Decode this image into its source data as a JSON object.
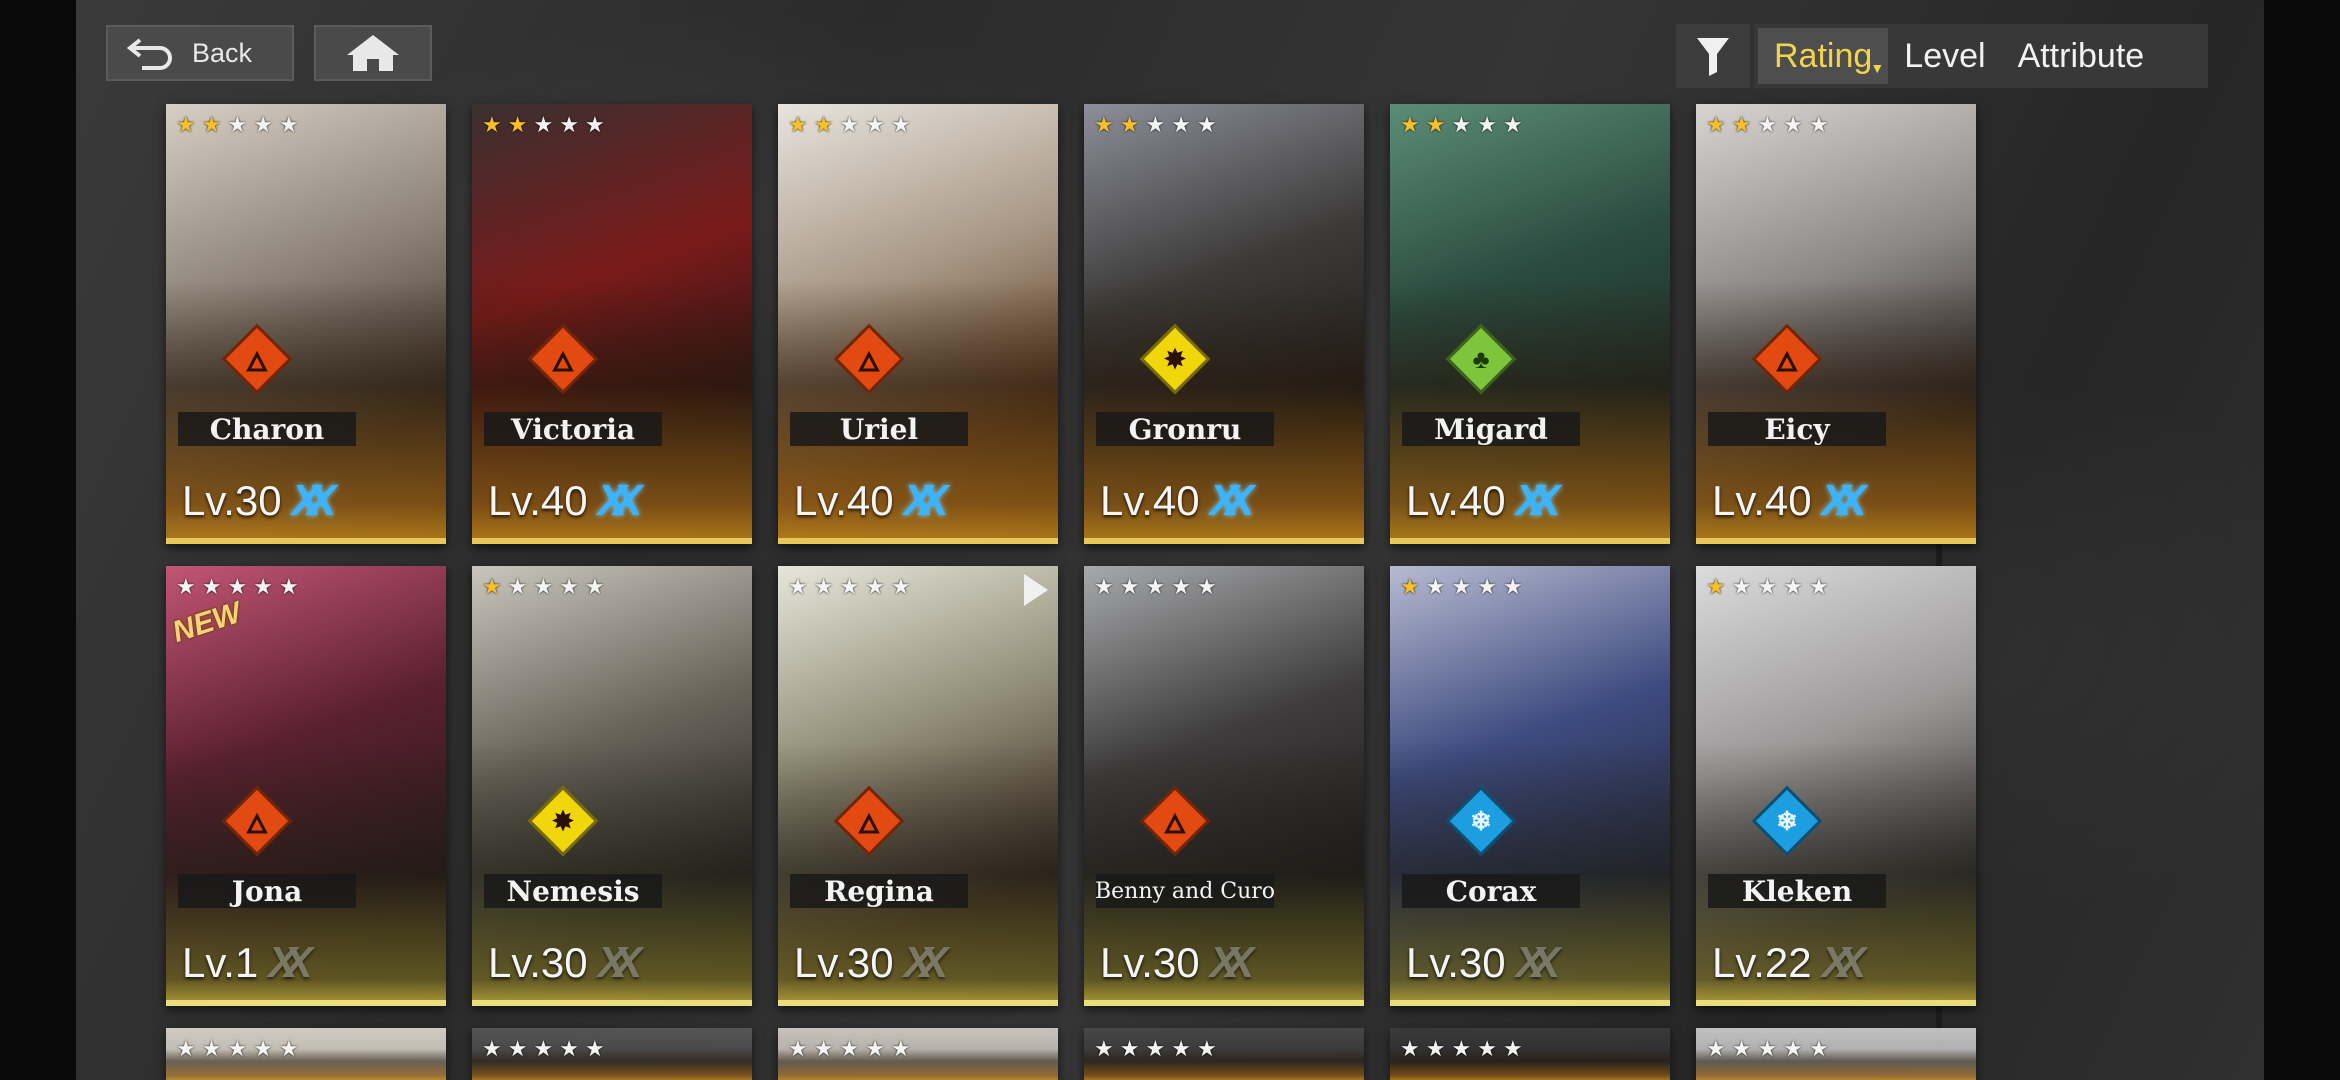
{
  "nav": {
    "back_label": "Back",
    "back_icon": "back-arrow-icon",
    "home_icon": "home-icon"
  },
  "sort": {
    "filter_icon": "filter-icon",
    "tabs": [
      {
        "label": "Rating",
        "active": true
      },
      {
        "label": "Level",
        "active": false
      },
      {
        "label": "Attribute",
        "active": false
      }
    ],
    "active_color": "#f1d44c"
  },
  "attribute_colors": {
    "fire": "#e24a12",
    "electric": "#f1d60c",
    "nature": "#7dc53a",
    "ice": "#1d9ee0"
  },
  "characters": [
    {
      "name": "Charon",
      "level": "Lv.30",
      "stars": 2,
      "attribute": "fire",
      "limit_break": true
    },
    {
      "name": "Victoria",
      "level": "Lv.40",
      "stars": 2,
      "attribute": "fire",
      "limit_break": true
    },
    {
      "name": "Uriel",
      "level": "Lv.40",
      "stars": 2,
      "attribute": "fire",
      "limit_break": true
    },
    {
      "name": "Gronru",
      "level": "Lv.40",
      "stars": 2,
      "attribute": "electric",
      "limit_break": true
    },
    {
      "name": "Migard",
      "level": "Lv.40",
      "stars": 2,
      "attribute": "nature",
      "limit_break": true
    },
    {
      "name": "Eicy",
      "level": "Lv.40",
      "stars": 2,
      "attribute": "fire",
      "limit_break": true
    },
    {
      "name": "Jona",
      "level": "Lv.1",
      "stars": 0,
      "attribute": "fire",
      "limit_break": false,
      "badge": "NEW"
    },
    {
      "name": "Nemesis",
      "level": "Lv.30",
      "stars": 1,
      "attribute": "electric",
      "limit_break": false
    },
    {
      "name": "Regina",
      "level": "Lv.30",
      "stars": 0,
      "attribute": "fire",
      "limit_break": false
    },
    {
      "name": "Benny and Curo",
      "level": "Lv.30",
      "stars": 0,
      "attribute": "fire",
      "limit_break": false
    },
    {
      "name": "Corax",
      "level": "Lv.30",
      "stars": 1,
      "attribute": "ice",
      "limit_break": false
    },
    {
      "name": "Kleken",
      "level": "Lv.22",
      "stars": 1,
      "attribute": "ice",
      "limit_break": false
    }
  ]
}
